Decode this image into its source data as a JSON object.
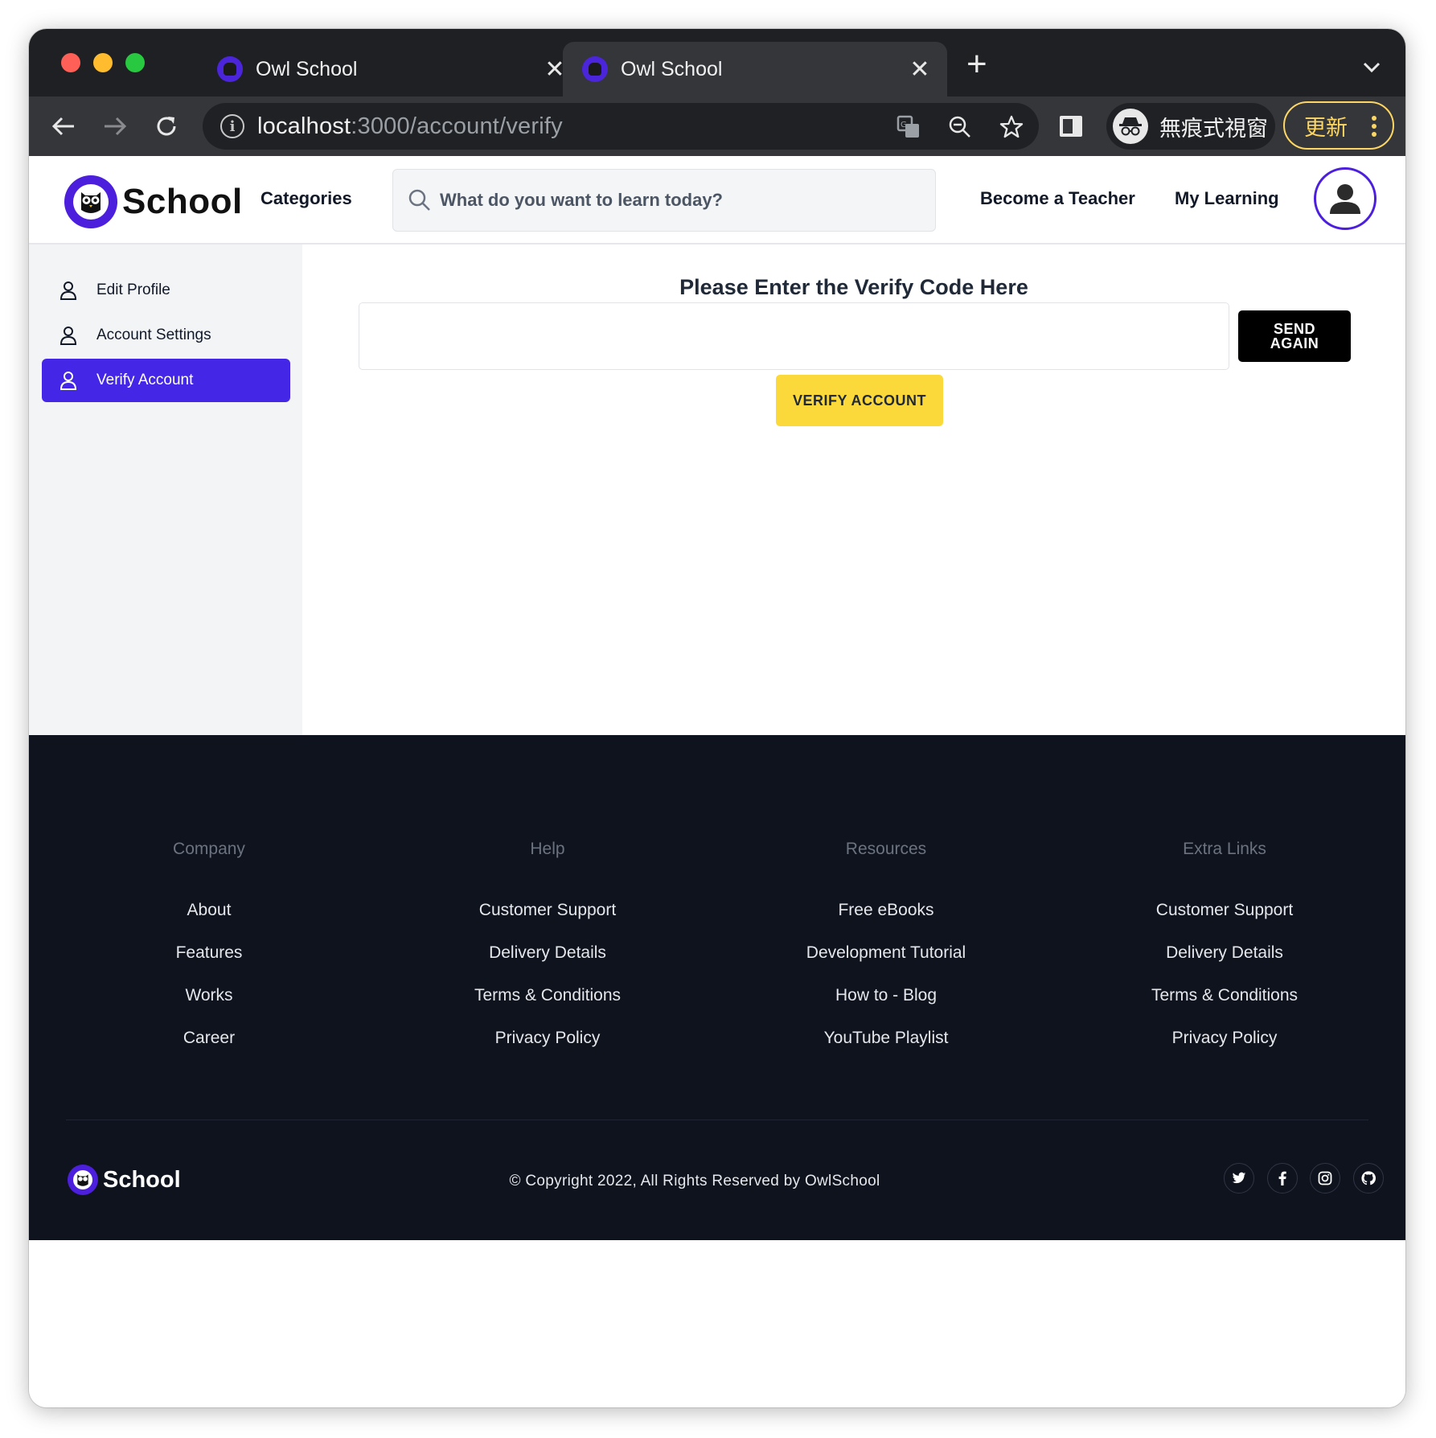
{
  "browser": {
    "tabs": [
      {
        "title": "Owl School",
        "active": false
      },
      {
        "title": "Owl School",
        "active": true
      }
    ],
    "url_host": "localhost",
    "url_path": ":3000/account/verify",
    "incognito_label": "無痕式視窗",
    "update_label": "更新"
  },
  "header": {
    "logo_text": "School",
    "categories": "Categories",
    "search_placeholder": "What do you want to learn today?",
    "become_teacher": "Become a Teacher",
    "my_learning": "My Learning"
  },
  "sidebar": {
    "items": [
      {
        "label": "Edit Profile",
        "active": false
      },
      {
        "label": "Account Settings",
        "active": false
      },
      {
        "label": "Verify Account",
        "active": true
      }
    ]
  },
  "main": {
    "title": "Please Enter the Verify Code Here",
    "code_value": "",
    "send_again_label": "SEND AGAIN",
    "verify_label": "VERIFY ACCOUNT"
  },
  "footer": {
    "columns": [
      {
        "heading": "Company",
        "links": [
          "About",
          "Features",
          "Works",
          "Career"
        ]
      },
      {
        "heading": "Help",
        "links": [
          "Customer Support",
          "Delivery Details",
          "Terms & Conditions",
          "Privacy Policy"
        ]
      },
      {
        "heading": "Resources",
        "links": [
          "Free eBooks",
          "Development Tutorial",
          "How to - Blog",
          "YouTube Playlist"
        ]
      },
      {
        "heading": "Extra Links",
        "links": [
          "Customer Support",
          "Delivery Details",
          "Terms & Conditions",
          "Privacy Policy"
        ]
      }
    ],
    "logo_text": "School",
    "copyright": "© Copyright 2022, All Rights Reserved by OwlSchool",
    "social_icons": [
      "twitter-icon",
      "facebook-icon",
      "instagram-icon",
      "github-icon"
    ]
  },
  "colors": {
    "brand_purple": "#4c1fdd",
    "sidebar_active": "#4326e6",
    "verify_yellow": "#fcd93b",
    "footer_bg": "#0f131e"
  }
}
